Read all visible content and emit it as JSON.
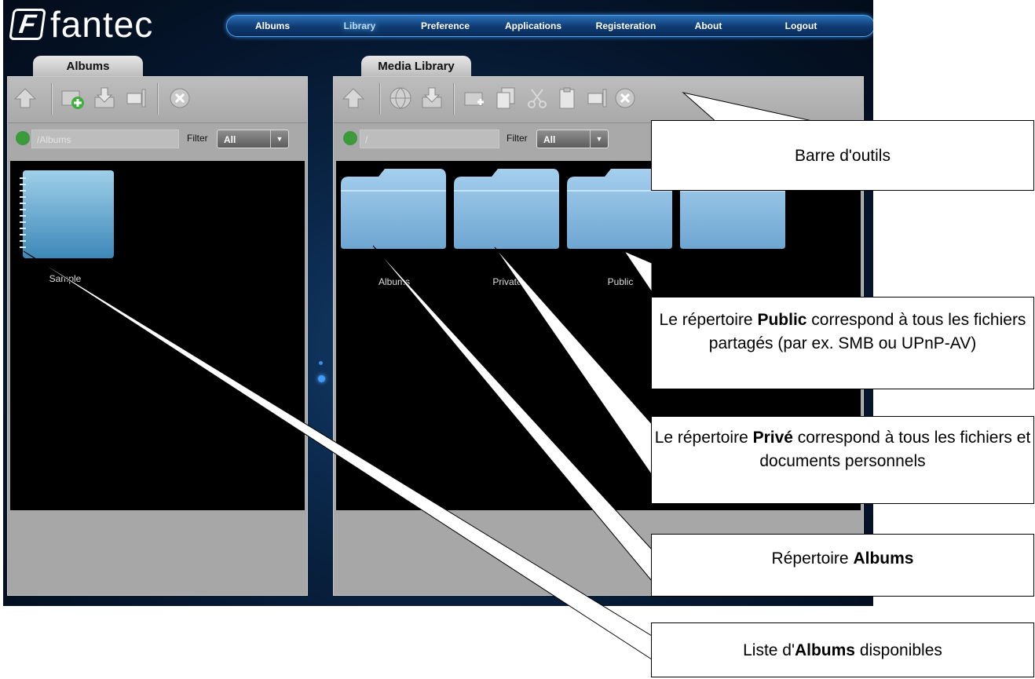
{
  "app": {
    "logo_text": "fantec",
    "logo_letter": "F"
  },
  "nav": {
    "items": [
      "Albums",
      "Library",
      "Preference",
      "Applications",
      "Registeration",
      "About",
      "Logout"
    ],
    "active": "Library"
  },
  "left_panel": {
    "tab": "Albums",
    "path_placeholder": "/Albums",
    "filter_label": "Filter",
    "filter_value": "All",
    "items": [
      {
        "label": "Sample",
        "icon": "album-icon"
      }
    ],
    "toolbar_icons": [
      "up-arrow-icon",
      "new-album-icon",
      "download-icon",
      "tv-icon",
      "delete-icon"
    ]
  },
  "right_panel": {
    "tab": "Media Library",
    "path_placeholder": "/",
    "filter_label": "Filter",
    "filter_value": "All",
    "items": [
      {
        "label": "Albums",
        "icon": "folder-icon"
      },
      {
        "label": "Private",
        "icon": "folder-icon"
      },
      {
        "label": "Public",
        "icon": "folder-icon"
      },
      {
        "label": "",
        "icon": "folder-icon"
      }
    ],
    "toolbar_icons": [
      "up-arrow-icon",
      "globe-icon",
      "download-icon",
      "new-folder-icon",
      "copy-icon",
      "cut-icon",
      "paste-icon",
      "tv-icon",
      "delete-icon"
    ]
  },
  "callouts": {
    "toolbar": "Barre d'outils",
    "public": {
      "pre": "Le répertoire ",
      "bold": "Public",
      "post": " correspond à tous les fichiers partagés (par ex. SMB ou UPnP-AV)"
    },
    "private": {
      "pre": "Le répertoire ",
      "bold": "Privé",
      "post": " correspond à tous les fichiers et documents personnels"
    },
    "albums": {
      "pre": "Répertoire ",
      "bold": "Albums",
      "post": ""
    },
    "album_list": {
      "pre": "Liste d'",
      "bold": "Albums",
      "post": " disponibles"
    }
  },
  "colors": {
    "nav_active": "#b9dcff",
    "background": "#0a2648",
    "folder": "#8fc1e6",
    "callout_border": "#000000"
  }
}
